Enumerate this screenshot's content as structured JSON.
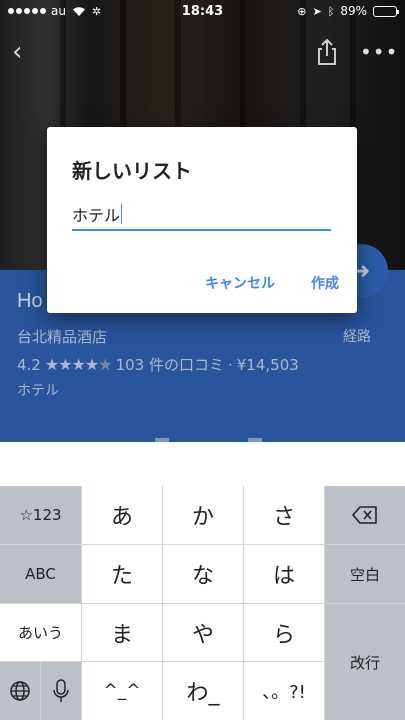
{
  "status_bar": {
    "carrier": "au",
    "time": "18:43",
    "battery_percent": "89%",
    "battery_level": 0.89,
    "icons": [
      "signal-dots-icon",
      "wifi-icon",
      "loading-icon",
      "orientation-lock-icon",
      "location-arrow-icon",
      "bluetooth-icon",
      "battery-icon"
    ]
  },
  "hero": {
    "icons": {
      "back": "back-chevron-icon",
      "share": "share-icon",
      "more": "more-dots-icon"
    },
    "back_glyph": "‹",
    "more_glyph": "•••"
  },
  "place": {
    "name_visible": "Ho",
    "subtitle": "台北精品酒店",
    "rating": "4.2",
    "stars_filled": "★★★★",
    "stars_empty": "★",
    "reviews": "103 件の口コミ",
    "separator": "·",
    "price": "¥14,503",
    "category": "ホテル",
    "directions_glyph": "➜",
    "directions_label": "経路"
  },
  "dialog": {
    "title": "新しいリスト",
    "input_value": "ホテル",
    "cancel_label": "キャンセル",
    "create_label": "作成"
  },
  "keyboard": {
    "left_column": [
      "☆123",
      "ABC",
      "あいう"
    ],
    "grid": [
      [
        "あ",
        "か",
        "さ"
      ],
      [
        "た",
        "な",
        "は"
      ],
      [
        "ま",
        "や",
        "ら"
      ],
      [
        "^_^",
        "わ_",
        "、。?!"
      ]
    ],
    "right_column": {
      "backspace_icon": "backspace-icon",
      "space": "空白",
      "return": "改行"
    },
    "bottom_left_icons": [
      "globe-icon",
      "microphone-icon"
    ]
  },
  "colors": {
    "accent_blue": "#4285f4",
    "place_card": "#28559b",
    "keyboard_bg": "#d1d5db",
    "dark_key": "#bcc1c8"
  }
}
